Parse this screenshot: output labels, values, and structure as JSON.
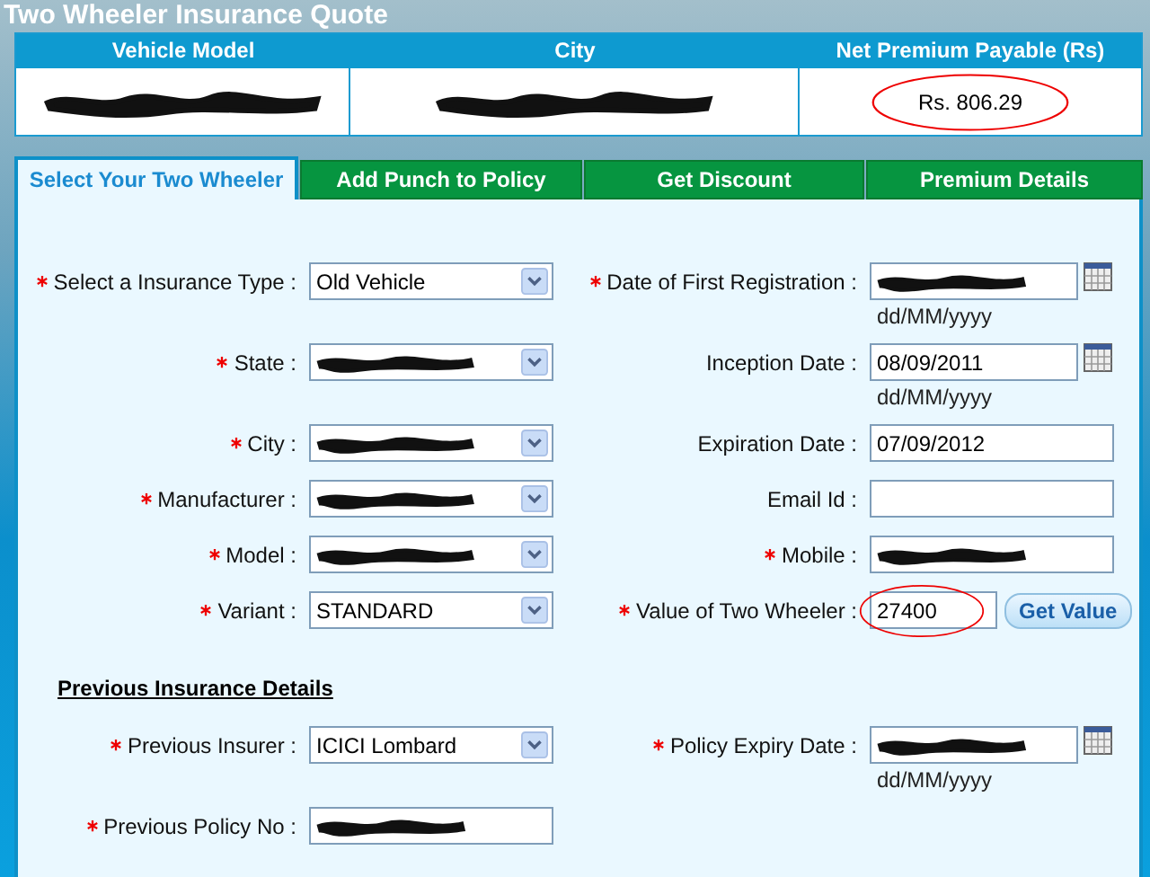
{
  "title": "Two Wheeler Insurance Quote",
  "summary": {
    "columns": [
      "Vehicle Model",
      "City",
      "Net Premium Payable (Rs)"
    ],
    "cells": [
      {
        "redacted": true
      },
      {
        "redacted": true
      },
      {
        "text": "Rs. 806.29",
        "circled": true
      }
    ]
  },
  "tabs": [
    {
      "label": "Select Your Two Wheeler",
      "selected": true
    },
    {
      "label": "Add Punch to Policy",
      "selected": false
    },
    {
      "label": "Get Discount",
      "selected": false
    },
    {
      "label": "Premium Details",
      "selected": false
    }
  ],
  "rows": [
    [
      {
        "label": "Select a Insurance Type :",
        "required": true,
        "kind": "select",
        "value": "Old Vehicle"
      },
      {
        "label": "Date of First Registration :",
        "required": true,
        "kind": "date",
        "redacted": true,
        "hint": "dd/MM/yyyy"
      }
    ],
    [
      {
        "label": "State :",
        "required": true,
        "kind": "select",
        "redacted": true
      },
      {
        "label": "Inception Date :",
        "required": false,
        "kind": "date",
        "value": "08/09/2011",
        "hint": "dd/MM/yyyy"
      }
    ],
    [
      {
        "label": "City :",
        "required": true,
        "kind": "select",
        "redacted": true
      },
      {
        "label": "Expiration Date :",
        "required": false,
        "kind": "text",
        "value": "07/09/2012"
      }
    ],
    [
      {
        "label": "Manufacturer :",
        "required": true,
        "kind": "select",
        "redacted": true
      },
      {
        "label": "Email Id :",
        "required": false,
        "kind": "text"
      }
    ],
    [
      {
        "label": "Model :",
        "required": true,
        "kind": "select",
        "redacted": true
      },
      {
        "label": "Mobile :",
        "required": true,
        "kind": "text",
        "redacted": true
      }
    ],
    [
      {
        "label": "Variant :",
        "required": true,
        "kind": "select",
        "value": "STANDARD"
      },
      {
        "label": "Value of Two Wheeler :",
        "required": true,
        "kind": "value",
        "value": "27400",
        "circled": true,
        "button": "Get Value"
      }
    ]
  ],
  "section": "Previous Insurance Details",
  "previous_rows": [
    [
      {
        "label": "Previous Insurer :",
        "required": true,
        "kind": "select",
        "value": "ICICI Lombard"
      },
      {
        "label": "Policy Expiry Date :",
        "required": true,
        "kind": "date",
        "redacted": true,
        "hint": "dd/MM/yyyy"
      }
    ],
    [
      {
        "label": "Previous Policy No :",
        "required": true,
        "kind": "text",
        "redacted": true
      }
    ]
  ]
}
